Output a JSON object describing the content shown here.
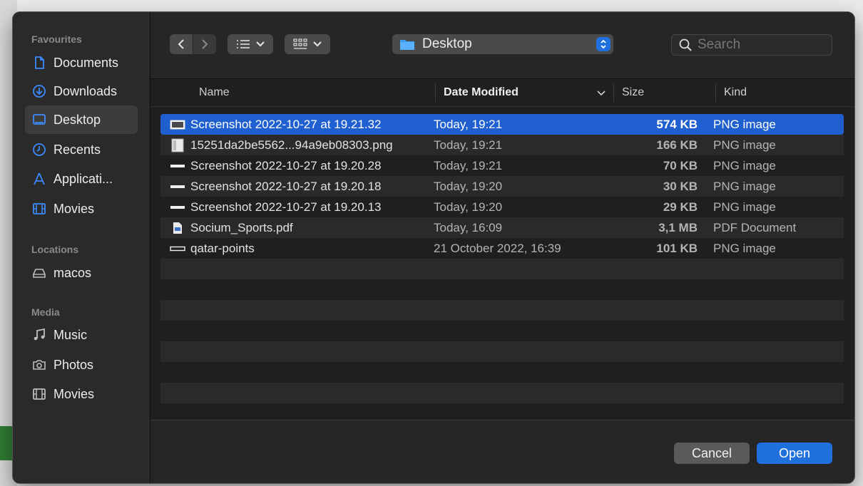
{
  "sidebar": {
    "favourites_label": "Favourites",
    "favourites": [
      {
        "label": "Documents",
        "icon": "document-icon",
        "active": false
      },
      {
        "label": "Downloads",
        "icon": "download-icon",
        "active": false
      },
      {
        "label": "Desktop",
        "icon": "desktop-icon",
        "active": true
      },
      {
        "label": "Recents",
        "icon": "clock-icon",
        "active": false
      },
      {
        "label": "Applicati...",
        "icon": "applications-icon",
        "active": false
      },
      {
        "label": "Movies",
        "icon": "film-icon",
        "active": false
      }
    ],
    "locations_label": "Locations",
    "locations": [
      {
        "label": "macos",
        "icon": "drive-icon"
      }
    ],
    "media_label": "Media",
    "media": [
      {
        "label": "Music",
        "icon": "music-icon"
      },
      {
        "label": "Photos",
        "icon": "camera-icon"
      },
      {
        "label": "Movies",
        "icon": "film-icon"
      }
    ]
  },
  "toolbar": {
    "location": "Desktop",
    "search_placeholder": "Search"
  },
  "table": {
    "columns": {
      "name": "Name",
      "date": "Date Modified",
      "size": "Size",
      "kind": "Kind"
    },
    "rows": [
      {
        "name": "Screenshot 2022-10-27 at 19.21.32",
        "date": "Today, 19:21",
        "size": "574 KB",
        "kind": "PNG image",
        "selected": true
      },
      {
        "name": "15251da2be5562...94a9eb08303.png",
        "date": "Today, 19:21",
        "size": "166 KB",
        "kind": "PNG image",
        "selected": false
      },
      {
        "name": "Screenshot 2022-10-27 at 19.20.28",
        "date": "Today, 19:21",
        "size": "70 KB",
        "kind": "PNG image",
        "selected": false
      },
      {
        "name": "Screenshot 2022-10-27 at 19.20.18",
        "date": "Today, 19:20",
        "size": "30 KB",
        "kind": "PNG image",
        "selected": false
      },
      {
        "name": "Screenshot 2022-10-27 at 19.20.13",
        "date": "Today, 19:20",
        "size": "29 KB",
        "kind": "PNG image",
        "selected": false
      },
      {
        "name": "Socium_Sports.pdf",
        "date": "Today, 16:09",
        "size": "3,1 MB",
        "kind": "PDF Document",
        "selected": false
      },
      {
        "name": "qatar-points",
        "date": "21 October 2022, 16:39",
        "size": "101 KB",
        "kind": "PNG image",
        "selected": false
      }
    ]
  },
  "footer": {
    "cancel_label": "Cancel",
    "open_label": "Open"
  },
  "colors": {
    "accent": "#1f6fdc",
    "selection": "#1f5fcf"
  }
}
